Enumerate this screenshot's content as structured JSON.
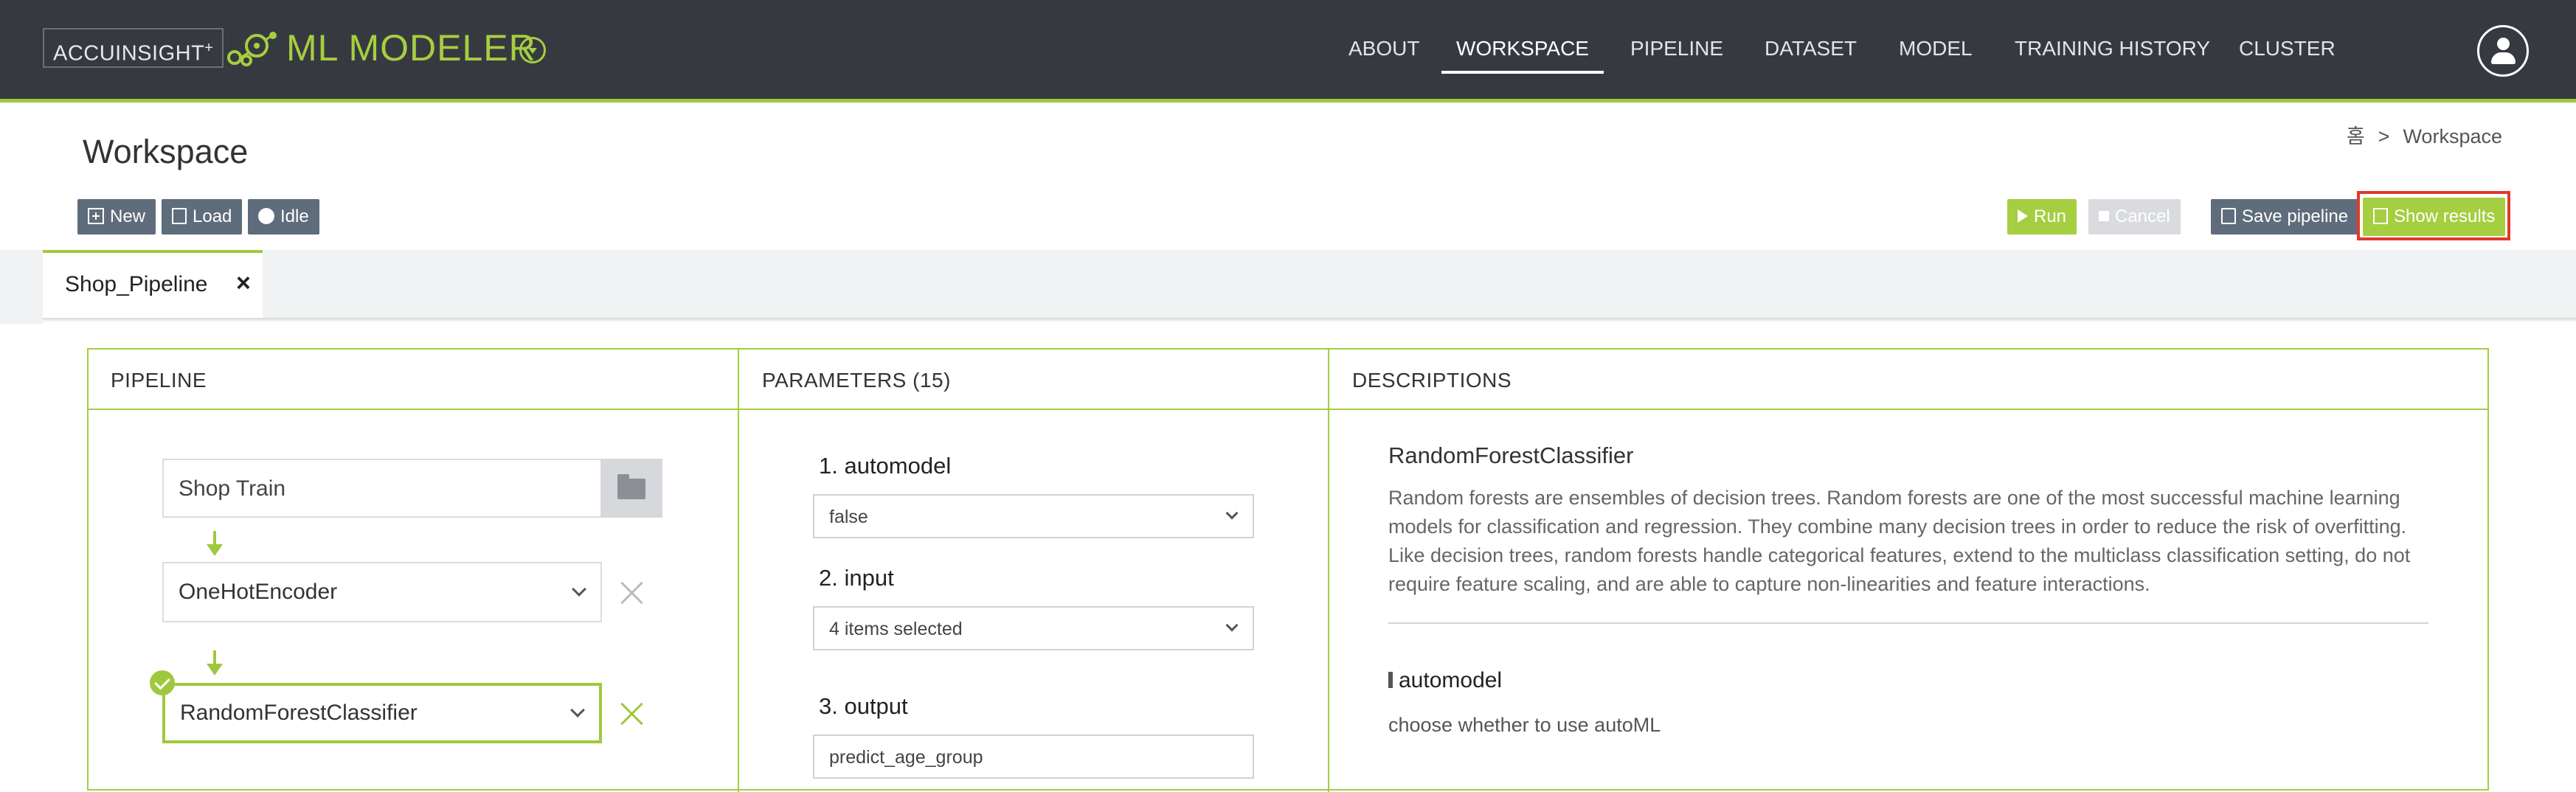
{
  "header": {
    "brand_label": "ACCUINSIGHT",
    "brand_plus": "+",
    "app_title": "ML MODELER",
    "nav": [
      {
        "label": "ABOUT",
        "active": false
      },
      {
        "label": "WORKSPACE",
        "active": true
      },
      {
        "label": "PIPELINE",
        "active": false
      },
      {
        "label": "DATASET",
        "active": false
      },
      {
        "label": "MODEL",
        "active": false
      },
      {
        "label": "TRAINING HISTORY",
        "active": false
      },
      {
        "label": "CLUSTER",
        "active": false
      }
    ],
    "user_icon": "user-icon"
  },
  "breadcrumb": {
    "home": "홈",
    "separator": ">",
    "current": "Workspace"
  },
  "page": {
    "title": "Workspace"
  },
  "toolbar": {
    "new_label": "New",
    "load_label": "Load",
    "status_label": "Idle",
    "run_label": "Run",
    "cancel_label": "Cancel",
    "save_label": "Save pipeline",
    "show_results_label": "Show results"
  },
  "tabs": [
    {
      "label": "Shop_Pipeline",
      "close": "×"
    }
  ],
  "panels": {
    "pipeline_title": "PIPELINE",
    "parameters_title": "PARAMETERS (15)",
    "descriptions_title": "DESCRIPTIONS"
  },
  "pipeline": {
    "dataset": "Shop Train",
    "steps": [
      {
        "label": "OneHotEncoder",
        "selected": false
      },
      {
        "label": "RandomForestClassifier",
        "selected": true
      }
    ]
  },
  "parameters": [
    {
      "label": "1. automodel",
      "value": "false"
    },
    {
      "label": "2. input",
      "value": "4 items selected"
    },
    {
      "label": "3. output",
      "value": "predict_age_group"
    }
  ],
  "descriptions": {
    "title": "RandomForestClassifier",
    "text": "Random forests are ensembles of decision trees. Random forests are one of the most successful machine learning models for classification and regression. They combine many decision trees in order to reduce the risk of overfitting. Like decision trees, random forests handle categorical features, extend to the multiclass classification setting, do not require feature scaling, and are able to capture non-linearities and feature interactions.",
    "param_name": "automodel",
    "param_text": "choose whether to use autoML"
  },
  "colors": {
    "topbar": "#363a40",
    "accent": "#9ec93d",
    "button_dark": "#5f6c7b",
    "highlight": "#e0392b"
  }
}
